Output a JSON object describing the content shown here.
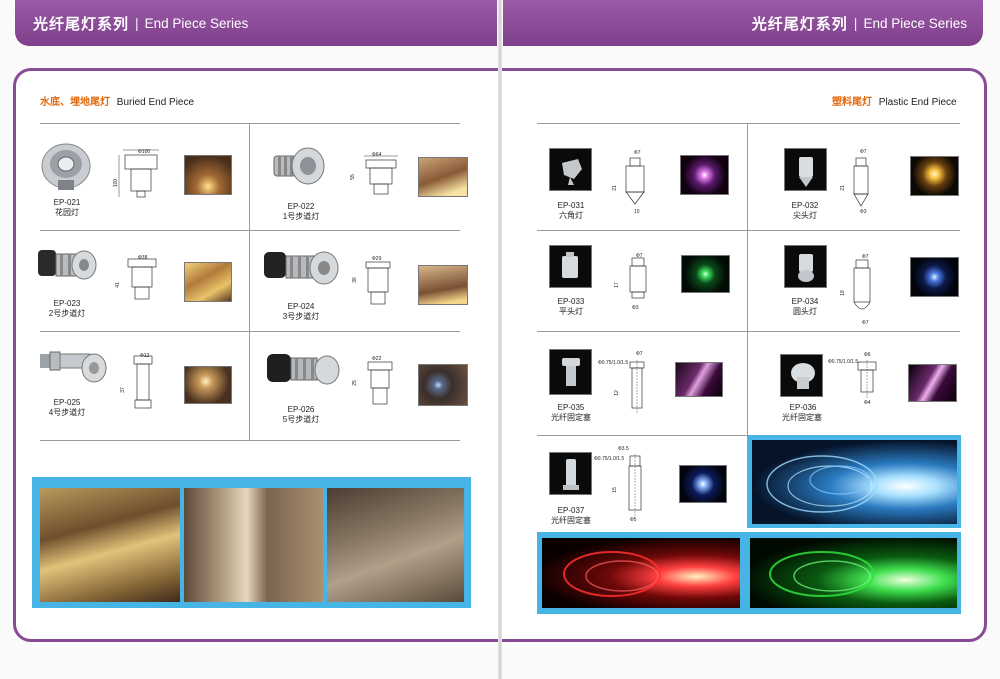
{
  "left_banner": {
    "title_cn": "光纤尾灯系列",
    "separator": "|",
    "title_en": "End Piece Series"
  },
  "right_banner": {
    "title_cn": "光纤尾灯系列",
    "separator": "|",
    "title_en": "End Piece Series"
  },
  "left_section": {
    "title_cn": "水底、埋地尾灯",
    "title_en": "Buried End Piece"
  },
  "right_section": {
    "title_cn": "塑料尾灯",
    "title_en": "Plastic End Piece"
  },
  "buried_products": [
    {
      "code": "EP-021",
      "name": "花园灯",
      "dims": [
        "Ф100",
        "100"
      ]
    },
    {
      "code": "EP-022",
      "name": "1号步道灯",
      "dims": [
        "Ф64",
        "55"
      ]
    },
    {
      "code": "EP-023",
      "name": "2号步道灯",
      "dims": [
        "Ф38",
        "41"
      ]
    },
    {
      "code": "EP-024",
      "name": "3号步道灯",
      "dims": [
        "Ф29",
        "36"
      ]
    },
    {
      "code": "EP-025",
      "name": "4号步道灯",
      "dims": [
        "Ф12",
        "37"
      ]
    },
    {
      "code": "EP-026",
      "name": "5号步道灯",
      "dims": [
        "Ф22",
        "25"
      ]
    }
  ],
  "plastic_products": [
    {
      "code": "EP-031",
      "name": "六角灯",
      "dims": [
        "Ф7",
        "21",
        "10"
      ]
    },
    {
      "code": "EP-032",
      "name": "尖头灯",
      "dims": [
        "Ф7",
        "21",
        "Ф3"
      ]
    },
    {
      "code": "EP-033",
      "name": "平头灯",
      "dims": [
        "Ф7",
        "17",
        "Ф3"
      ]
    },
    {
      "code": "EP-034",
      "name": "圆头灯",
      "dims": [
        "Ф7",
        "18",
        "Ф7"
      ]
    },
    {
      "code": "EP-035",
      "name": "光纤固定塞",
      "dims": [
        "Ф0.75/1.0/1.5",
        "Ф7",
        "12"
      ]
    },
    {
      "code": "EP-036",
      "name": "光纤固定塞",
      "dims": [
        "Ф0.75/1.0/1.5",
        "Ф6",
        "Ф4"
      ]
    },
    {
      "code": "EP-037",
      "name": "光纤固定塞",
      "dims": [
        "Ф3.5",
        "Ф0.75/1.0/1.5",
        "15",
        "Ф5"
      ]
    }
  ],
  "colors": {
    "banner": "#8a4b96",
    "frame": "#8a4b96",
    "section_cn": "#e06a10",
    "blue_band": "#46b5e6"
  }
}
